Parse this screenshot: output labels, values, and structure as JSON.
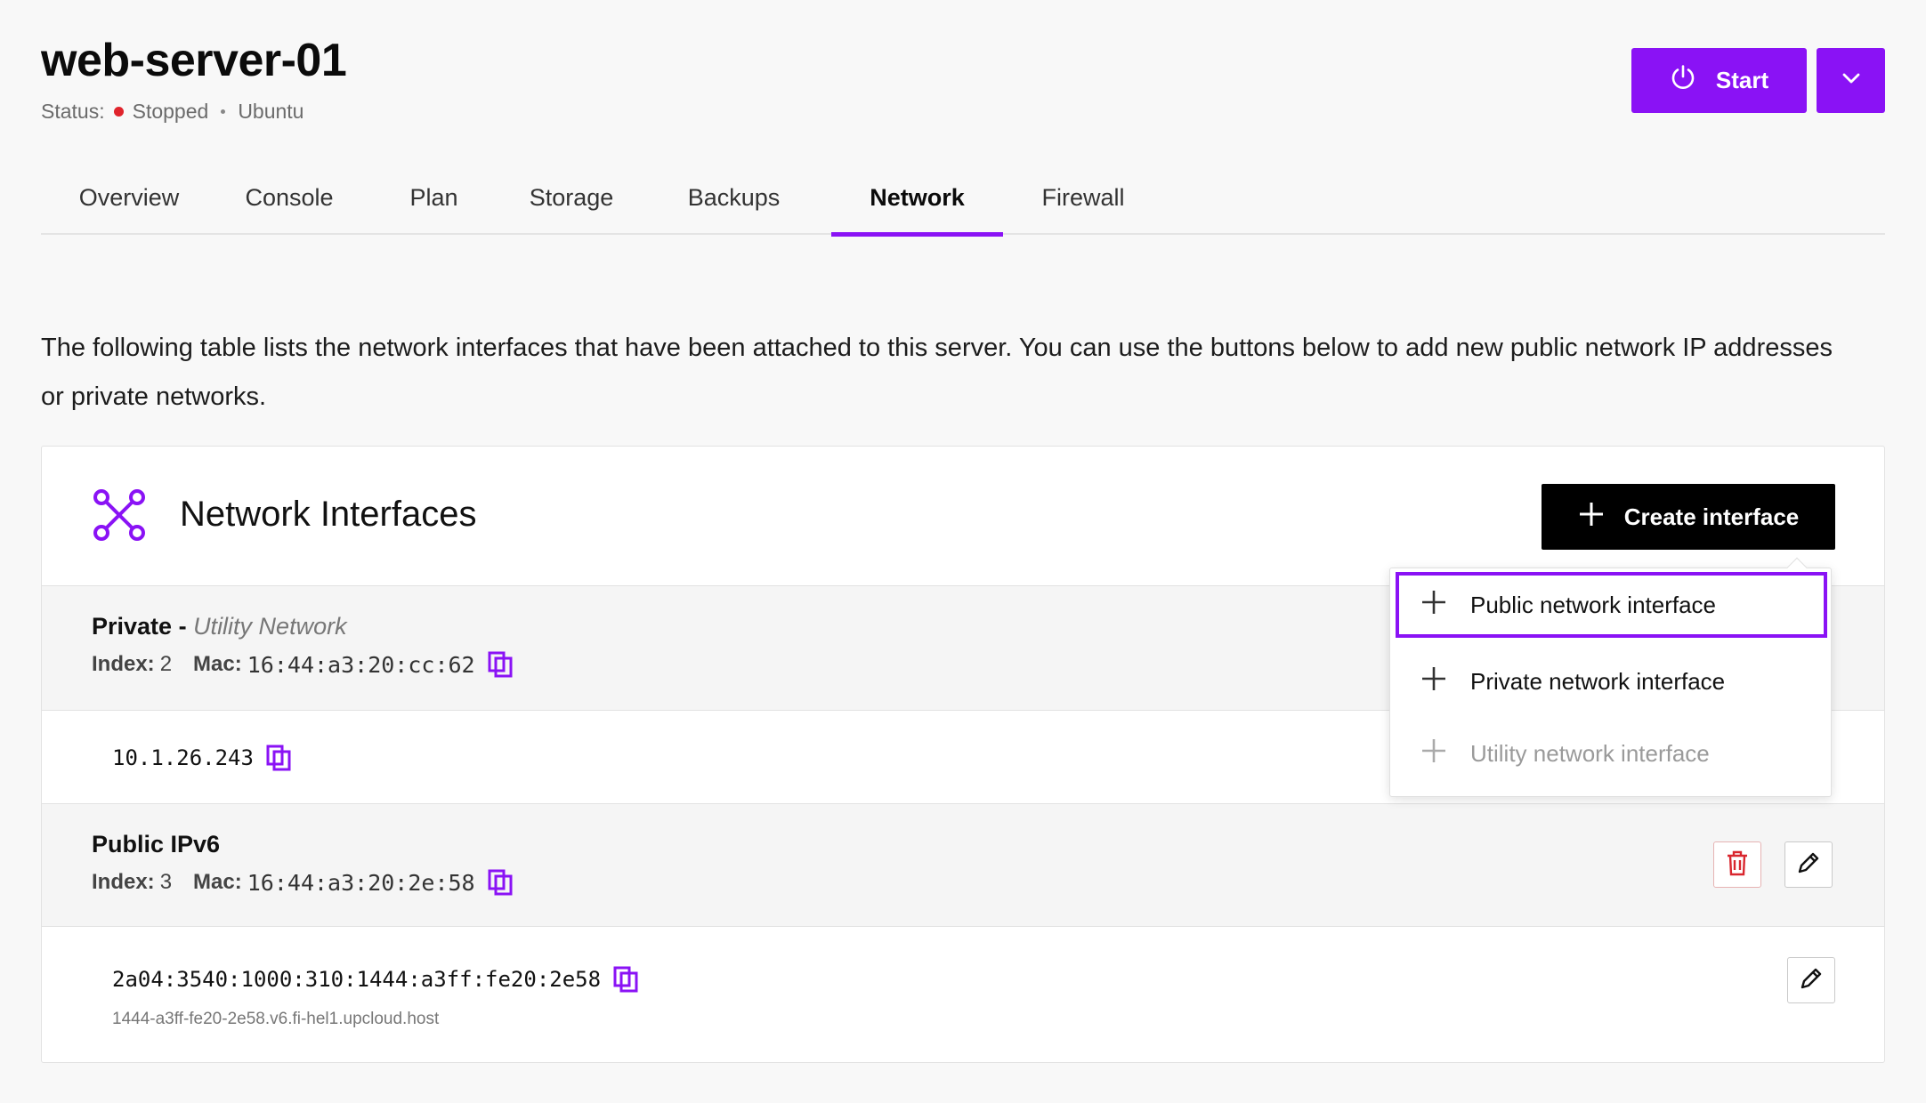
{
  "server": {
    "title": "web-server-01",
    "status_label": "Status:",
    "status_value": "Stopped",
    "os": "Ubuntu"
  },
  "actions": {
    "start_label": "Start"
  },
  "tabs": [
    {
      "label": "Overview"
    },
    {
      "label": "Console"
    },
    {
      "label": "Plan"
    },
    {
      "label": "Storage"
    },
    {
      "label": "Backups"
    },
    {
      "label": "Network",
      "active": true
    },
    {
      "label": "Firewall"
    }
  ],
  "description": "The following table lists the network interfaces that have been attached to this server. You can use the buttons below to add new public network IP addresses or private networks.",
  "card": {
    "title": "Network Interfaces",
    "create_label": "Create interface"
  },
  "dropdown": {
    "items": [
      {
        "label": "Public network interface",
        "state": "focused"
      },
      {
        "label": "Private network interface",
        "state": "normal"
      },
      {
        "label": "Utility network interface",
        "state": "disabled"
      }
    ]
  },
  "interfaces": [
    {
      "type": "Private",
      "separator": " - ",
      "network": "Utility Network",
      "index_label": "Index:",
      "index": "2",
      "mac_label": "Mac:",
      "mac": "16:44:a3:20:cc:62",
      "ip": "10.1.26.243"
    },
    {
      "type": "Public IPv6",
      "index_label": "Index:",
      "index": "3",
      "mac_label": "Mac:",
      "mac": "16:44:a3:20:2e:58",
      "ip": "2a04:3540:1000:310:1444:a3ff:fe20:2e58",
      "hostname": "1444-a3ff-fe20-2e58.v6.fi-hel1.upcloud.host"
    }
  ],
  "colors": {
    "accent": "#8a12f5",
    "status_stopped": "#e0242c",
    "danger": "#d9262e"
  }
}
